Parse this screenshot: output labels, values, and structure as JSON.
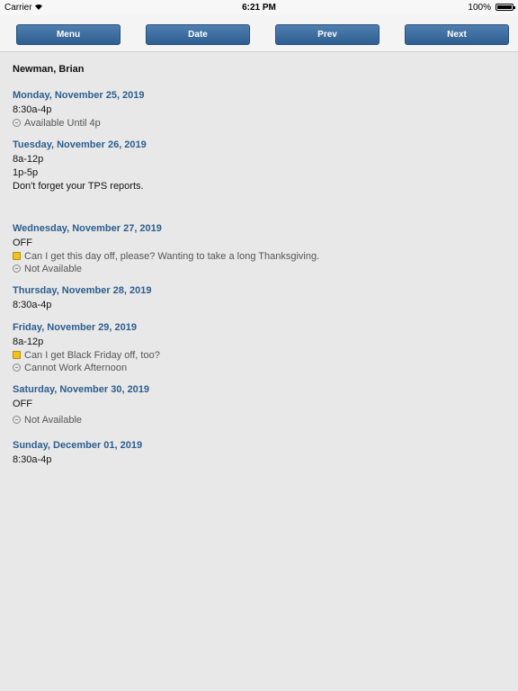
{
  "status": {
    "carrier": "Carrier",
    "time": "6:21 PM",
    "battery": "100%"
  },
  "toolbar": {
    "menu": "Menu",
    "date": "Date",
    "prev": "Prev",
    "next": "Next"
  },
  "employee": "Newman, Brian",
  "days": [
    {
      "title": "Monday, November 25, 2019",
      "shifts": [
        "8:30a-4p"
      ],
      "notes": [
        {
          "type": "availability",
          "text": "Available Until 4p"
        }
      ]
    },
    {
      "title": "Tuesday, November 26, 2019",
      "shifts": [
        "8a-12p",
        "1p-5p",
        "Don't forget your TPS reports."
      ],
      "notes": []
    },
    {
      "title": "Wednesday, November 27, 2019",
      "shifts": [
        "OFF"
      ],
      "notes": [
        {
          "type": "message",
          "text": "Can I get this day off, please? Wanting to take a long Thanksgiving."
        },
        {
          "type": "availability",
          "text": "Not Available"
        }
      ]
    },
    {
      "title": "Thursday, November 28, 2019",
      "shifts": [
        "8:30a-4p"
      ],
      "notes": []
    },
    {
      "title": "Friday, November 29, 2019",
      "shifts": [
        "8a-12p"
      ],
      "notes": [
        {
          "type": "message",
          "text": "Can I get Black Friday off, too?"
        },
        {
          "type": "availability",
          "text": "Cannot Work Afternoon"
        }
      ]
    },
    {
      "title": "Saturday, November 30, 2019",
      "shifts": [
        "OFF"
      ],
      "notes": [
        {
          "type": "availability",
          "text": "Not Available"
        }
      ]
    },
    {
      "title": "Sunday, December 01, 2019",
      "shifts": [
        "8:30a-4p"
      ],
      "notes": []
    }
  ]
}
